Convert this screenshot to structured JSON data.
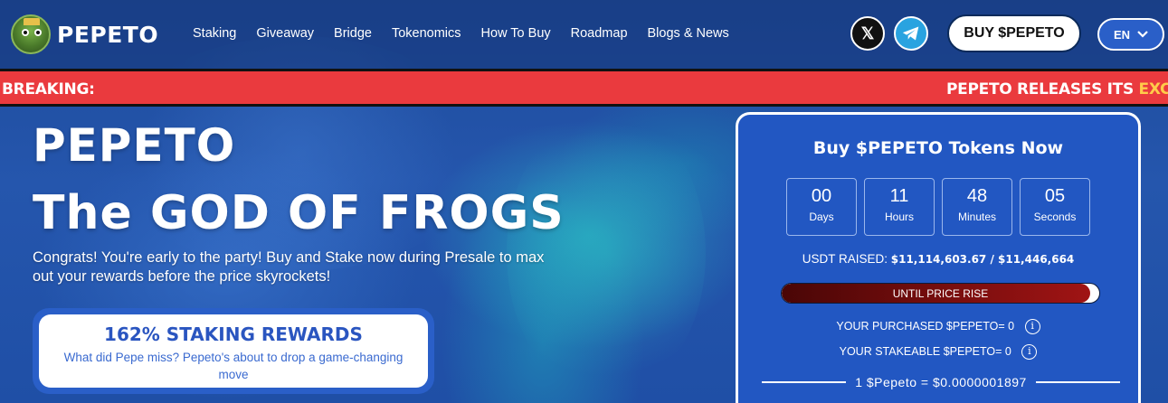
{
  "nav": {
    "brand": "PEPETO",
    "menu": [
      "Staking",
      "Giveaway",
      "Bridge",
      "Tokenomics",
      "How To Buy",
      "Roadmap",
      "Blogs & News"
    ],
    "x_glyph": "𝕏",
    "buy_label": "BUY $PEPETO",
    "lang": "EN"
  },
  "ticker": {
    "label": "BREAKING:",
    "message": "PEPETO RELEASES ITS ",
    "highlight": "EXCHA"
  },
  "hero": {
    "line1": "PEPETO",
    "line2": "The GOD OF FROGS",
    "subtitle": "Congrats! You're early to the party! Buy and Stake now during Presale to max out your rewards before the price skyrockets!",
    "stake_title": "162% STAKING REWARDS",
    "stake_desc": "What did Pepe miss? Pepeto's about to drop a game-changing move"
  },
  "panel": {
    "title": "Buy $PEPETO Tokens Now",
    "countdown": [
      {
        "value": "00",
        "unit": "Days"
      },
      {
        "value": "11",
        "unit": "Hours"
      },
      {
        "value": "48",
        "unit": "Minutes"
      },
      {
        "value": "05",
        "unit": "Seconds"
      }
    ],
    "raised_label": "USDT RAISED:",
    "raised_value": "$11,114,603.67 / $11,446,664",
    "progress": 0.971,
    "progress_label": "UNTIL PRICE RISE",
    "purchased": "YOUR PURCHASED $PEPETO= 0",
    "stakeable": "YOUR STAKEABLE $PEPETO= 0",
    "info_glyph": "i",
    "price": "1 $Pepeto = $0.0000001897"
  },
  "colors": {
    "background": "#1f4fa6",
    "ticker_bg": "#ea3a3e",
    "panel_bg": "#2257c2",
    "accent_blue": "#2a5fc8",
    "progress_fill": "#8b1010",
    "highlight": "#ffcc4a"
  },
  "icons": [
    "pepe-logo",
    "x-icon",
    "telegram-icon",
    "chevron-down-icon",
    "info-icon"
  ]
}
